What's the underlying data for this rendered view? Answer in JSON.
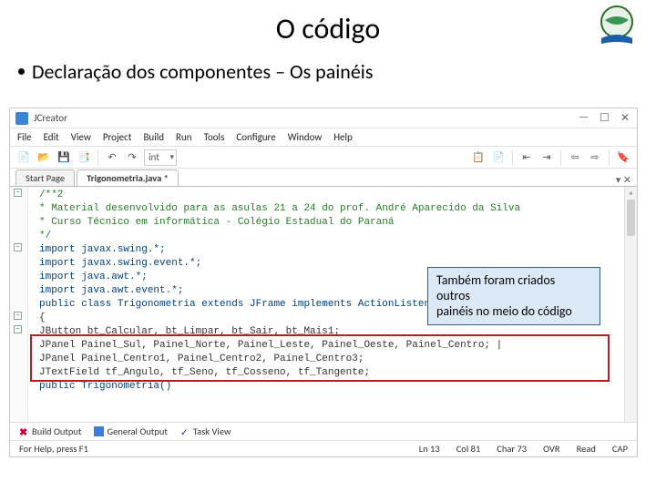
{
  "slide": {
    "title": "O código",
    "bullet": "Declaração dos componentes – Os painéis"
  },
  "callout": {
    "line1": "Também foram criados outros",
    "line2": "painéis no meio do código"
  },
  "ide": {
    "app_name": "JCreator",
    "menu": [
      "File",
      "Edit",
      "View",
      "Project",
      "Build",
      "Run",
      "Tools",
      "Configure",
      "Window",
      "Help"
    ],
    "toolbar": {
      "dropdown_value": "int"
    },
    "tabs": [
      {
        "label": "Start Page",
        "active": false
      },
      {
        "label": "Trigonometria.java *",
        "active": true
      }
    ],
    "code": [
      {
        "cls": "c-comment",
        "text": "/**2"
      },
      {
        "cls": "c-comment",
        "text": " * Material desenvolvido para as asulas 21 a 24 do prof. André Aparecido da Silva"
      },
      {
        "cls": "c-comment",
        "text": " * Curso Técnico em informática - Colégio Estadual do Paraná"
      },
      {
        "cls": "c-comment",
        "text": " */"
      },
      {
        "cls": "c-keyword",
        "text": "import javax.swing.*;"
      },
      {
        "cls": "c-keyword",
        "text": "import javax.swing.event.*;"
      },
      {
        "cls": "c-keyword",
        "text": "import java.awt.*;"
      },
      {
        "cls": "c-keyword",
        "text": "import java.awt.event.*;"
      },
      {
        "cls": "c-plain",
        "text": ""
      },
      {
        "cls": "c-keyword",
        "text": "public class Trigonometria extends JFrame implements ActionListener"
      },
      {
        "cls": "c-plain",
        "text": "{"
      },
      {
        "cls": "c-plain",
        "text": "    JButton bt_Calcular, bt_Limpar, bt_Sair, bt_Mais1;"
      },
      {
        "cls": "c-plain",
        "text": "    JPanel Painel_Sul, Painel_Norte, Painel_Leste, Painel_Oeste, Painel_Centro; |"
      },
      {
        "cls": "c-plain",
        "text": "    JPanel Painel_Centro1, Painel_Centro2, Painel_Centro3;"
      },
      {
        "cls": "c-plain",
        "text": "    JTextField tf_Angulo, tf_Seno, tf_Cosseno, tf_Tangente;"
      },
      {
        "cls": "c-keyword",
        "text": "    public Trigonometria()"
      }
    ],
    "bottom_tabs": [
      "Build Output",
      "General Output",
      "Task View"
    ],
    "status": {
      "help": "For Help, press F1",
      "ln": "Ln 13",
      "col": "Col 81",
      "char": "Char 73",
      "ovr": "OVR",
      "read": "Read",
      "caps": "CAP"
    }
  }
}
